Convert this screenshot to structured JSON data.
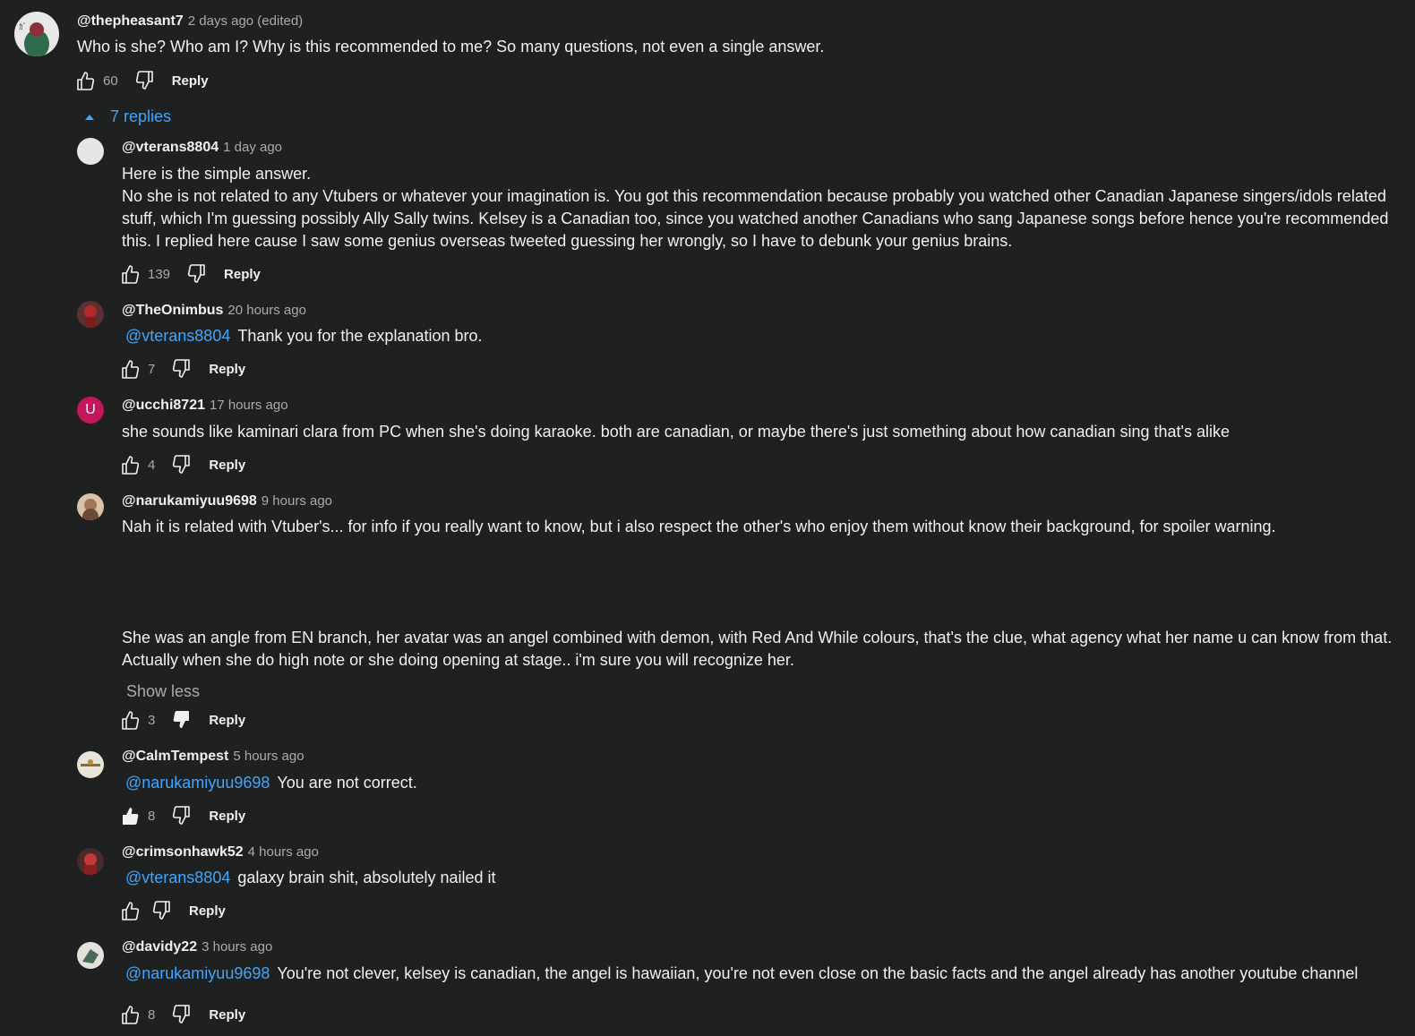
{
  "thread": {
    "author": "@thepheasant7",
    "time": "2 days ago (edited)",
    "text": "Who is she? Who am I? Why is this recommended to me? So many questions, not even a single answer.",
    "likes": "60",
    "reply_label": "Reply",
    "replies_toggle_label": "7 replies"
  },
  "replies": [
    {
      "author": "@vterans8804",
      "time": "1 day ago",
      "lines": [
        "Here is the simple answer.",
        "No she is not related to any Vtubers or whatever your imagination is. You got this recommendation because probably you watched other Canadian Japanese singers/idols related stuff, which I'm guessing possibly Ally Sally twins. Kelsey is a Canadian too, since you watched another Canadians who sang Japanese songs before hence you're recommended this. I replied here cause I saw some genius overseas tweeted guessing her wrongly, so I have to debunk your genius brains."
      ],
      "likes": "139",
      "reply_label": "Reply"
    },
    {
      "author": "@TheOnimbus",
      "time": "20 hours ago",
      "mention": "@vterans8804",
      "text": "Thank you for the explanation bro.",
      "likes": "7",
      "reply_label": "Reply"
    },
    {
      "author": "@ucchi8721",
      "time": "17 hours ago",
      "avatar_letter": "U",
      "text": "she sounds like kaminari clara from PC when she's doing karaoke.  both are canadian, or maybe there's just something about how canadian sing that's alike",
      "likes": "4",
      "reply_label": "Reply"
    },
    {
      "author": "@narukamiyuu9698",
      "time": "9 hours ago",
      "text": "Nah it is related with Vtuber's... for info if you really want to know, but i also respect the other's who enjoy them without know their background, for spoiler warning.",
      "text2_lines": [
        "She was an angle from EN branch, her avatar was an angel combined with demon, with Red And While colours, that's the clue, what agency what her name u can know from that.",
        "Actually when she do high note or she doing opening at stage.. i'm sure you will recognize her."
      ],
      "show_less": "Show less",
      "likes": "3",
      "reply_label": "Reply"
    },
    {
      "author": "@CalmTempest",
      "time": "5 hours ago",
      "mention": "@narukamiyuu9698",
      "text": "You are not correct.",
      "likes": "8",
      "reply_label": "Reply"
    },
    {
      "author": "@crimsonhawk52",
      "time": "4 hours ago",
      "mention": "@vterans8804",
      "text": "galaxy brain shit, absolutely nailed it",
      "likes": "",
      "reply_label": "Reply"
    },
    {
      "author": "@davidy22",
      "time": "3 hours ago",
      "mention": "@narukamiyuu9698",
      "text": "You're not clever, kelsey is canadian, the angel is hawaiian, you're not even close on the basic facts and the angel already has another youtube channel",
      "likes": "8",
      "reply_label": "Reply"
    }
  ],
  "colors": {
    "background": "#1f2020",
    "text": "#f1f1f1",
    "secondary": "#aaaaaa",
    "link": "#3ea6ff",
    "ucchi_avatar": "#c2185b"
  },
  "icons": {
    "like": "thumb-up-icon",
    "dislike": "thumb-down-icon",
    "collapse": "caret-up-icon"
  }
}
